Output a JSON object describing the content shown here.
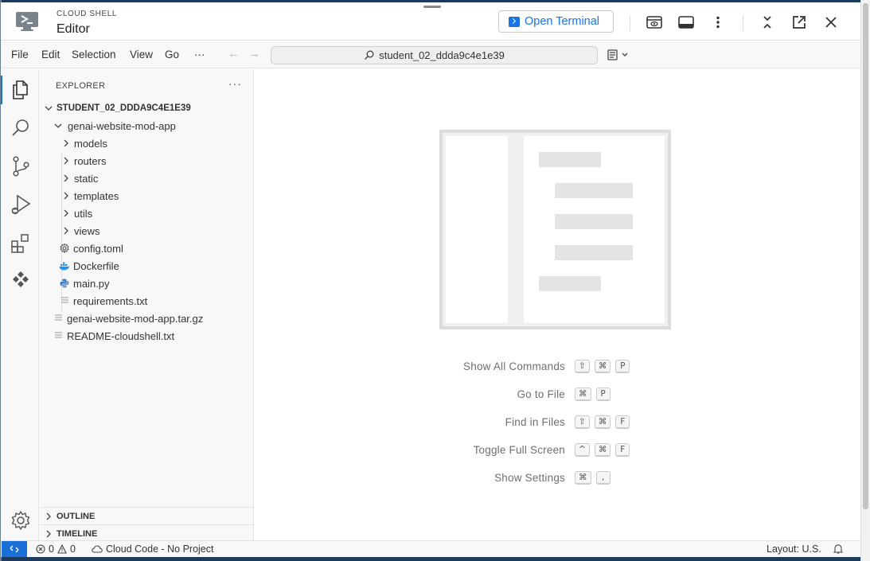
{
  "header": {
    "subtitle": "CLOUD SHELL",
    "title": "Editor",
    "open_terminal_label": "Open Terminal"
  },
  "menubar": {
    "items": [
      "File",
      "Edit",
      "Selection",
      "View",
      "Go",
      "···"
    ],
    "search_text": "student_02_ddda9c4e1e39"
  },
  "sidebar": {
    "title": "EXPLORER",
    "more": "···",
    "workspace_root": "STUDENT_02_DDDA9C4E1E39",
    "tree": [
      {
        "label": "genai-website-mod-app",
        "type": "folder-open"
      },
      {
        "label": "models",
        "type": "folder"
      },
      {
        "label": "routers",
        "type": "folder"
      },
      {
        "label": "static",
        "type": "folder"
      },
      {
        "label": "templates",
        "type": "folder"
      },
      {
        "label": "utils",
        "type": "folder"
      },
      {
        "label": "views",
        "type": "folder"
      },
      {
        "label": "config.toml",
        "type": "file",
        "icon": "gear-icon"
      },
      {
        "label": "Dockerfile",
        "type": "file",
        "icon": "docker-icon"
      },
      {
        "label": "main.py",
        "type": "file",
        "icon": "python-icon"
      },
      {
        "label": "requirements.txt",
        "type": "file",
        "icon": "text-file-icon"
      },
      {
        "label": "genai-website-mod-app.tar.gz",
        "type": "file",
        "icon": "text-file-icon"
      },
      {
        "label": "README-cloudshell.txt",
        "type": "file",
        "icon": "text-file-icon"
      }
    ],
    "sections": [
      "OUTLINE",
      "TIMELINE"
    ]
  },
  "editor": {
    "shortcuts": [
      {
        "label": "Show All Commands",
        "keys": [
          "⇧",
          "⌘",
          "P"
        ]
      },
      {
        "label": "Go to File",
        "keys": [
          "⌘",
          "P"
        ]
      },
      {
        "label": "Find in Files",
        "keys": [
          "⇧",
          "⌘",
          "F"
        ]
      },
      {
        "label": "Toggle Full Screen",
        "keys": [
          "^",
          "⌘",
          "F"
        ]
      },
      {
        "label": "Show Settings",
        "keys": [
          "⌘",
          ","
        ]
      }
    ]
  },
  "statusbar": {
    "errors": "0",
    "warnings": "0",
    "cloud_code": "Cloud Code - No Project",
    "layout": "Layout: U.S."
  },
  "colors": {
    "accent": "#1a73e8",
    "remote": "#1a6fd6",
    "python": "#3b7bbf",
    "docker": "#2496ed"
  }
}
